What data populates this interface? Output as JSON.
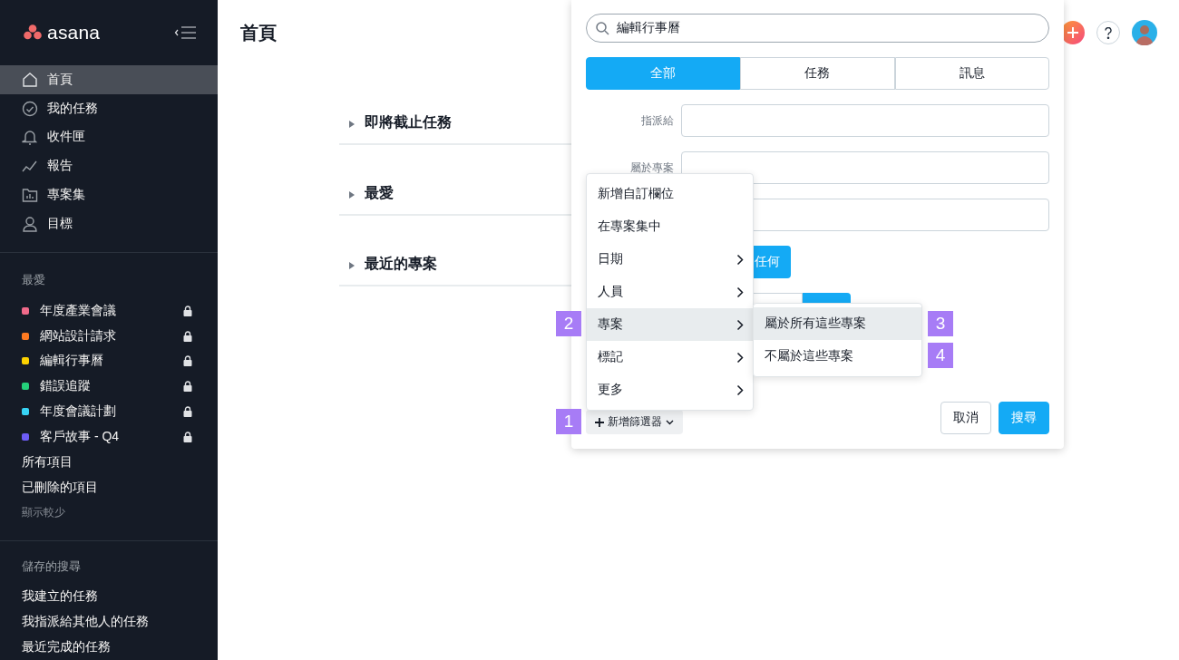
{
  "sidebar": {
    "logo": "asana",
    "nav": [
      {
        "label": "首頁",
        "selected": true
      },
      {
        "label": "我的任務",
        "selected": false
      },
      {
        "label": "收件匣",
        "selected": false
      },
      {
        "label": "報告",
        "selected": false
      },
      {
        "label": "專案集",
        "selected": false
      },
      {
        "label": "目標",
        "selected": false
      }
    ],
    "favorites": {
      "title": "最愛",
      "items": [
        {
          "label": "年度產業會議",
          "color": "#f06a8a",
          "locked": true
        },
        {
          "label": "網站設計請求",
          "color": "#fd7a21",
          "locked": true
        },
        {
          "label": "編輯行事曆",
          "color": "#fcd200",
          "locked": true
        },
        {
          "label": "錯誤追蹤",
          "color": "#24d07a",
          "locked": true
        },
        {
          "label": "年度會議計劃",
          "color": "#37d4f5",
          "locked": true
        },
        {
          "label": "客戶故事 - Q4",
          "color": "#6d5cf6",
          "locked": true
        }
      ]
    },
    "links": [
      "所有項目",
      "已刪除的項目"
    ],
    "toggle": "顯示較少",
    "saved_searches": {
      "title": "儲存的搜尋",
      "items": [
        "我建立的任務",
        "我指派給其他人的任務",
        "最近完成的任務"
      ]
    }
  },
  "page": {
    "title": "首頁",
    "sections": [
      {
        "label": "即將截止任務",
        "expanded": false
      },
      {
        "label": "最愛",
        "expanded": false
      },
      {
        "label": "最近的專案",
        "expanded": false
      }
    ]
  },
  "search_panel": {
    "query": "編輯行事曆",
    "tabs": [
      {
        "label": "全部",
        "selected": true
      },
      {
        "label": "任務",
        "selected": false
      },
      {
        "label": "訊息",
        "selected": false
      }
    ],
    "rows": [
      {
        "kind": "field",
        "label": "指派給"
      },
      {
        "kind": "field",
        "label": "屬於專案"
      },
      {
        "kind": "field"
      },
      {
        "kind": "button",
        "label": "任何"
      },
      {
        "kind": "split"
      }
    ],
    "add_filter": "新增篩選器",
    "buttons": [
      {
        "label": "取消",
        "kind": "secondary"
      },
      {
        "label": "搜尋",
        "kind": "primary"
      }
    ]
  },
  "filter_menu": {
    "items": [
      {
        "label": "新增自訂欄位",
        "submenu": false,
        "selected": false
      },
      {
        "label": "在專案集中",
        "submenu": false,
        "selected": false
      },
      {
        "label": "日期",
        "submenu": true,
        "selected": false
      },
      {
        "label": "人員",
        "submenu": true,
        "selected": false
      },
      {
        "label": "專案",
        "submenu": true,
        "selected": true
      },
      {
        "label": "標記",
        "submenu": true,
        "selected": false
      },
      {
        "label": "更多",
        "submenu": true,
        "selected": false
      }
    ]
  },
  "submenu": {
    "items": [
      {
        "label": "屬於所有這些專案",
        "selected": true
      },
      {
        "label": "不屬於這些專案",
        "selected": false
      }
    ]
  },
  "callouts": [
    "2",
    "3",
    "4",
    "1"
  ]
}
